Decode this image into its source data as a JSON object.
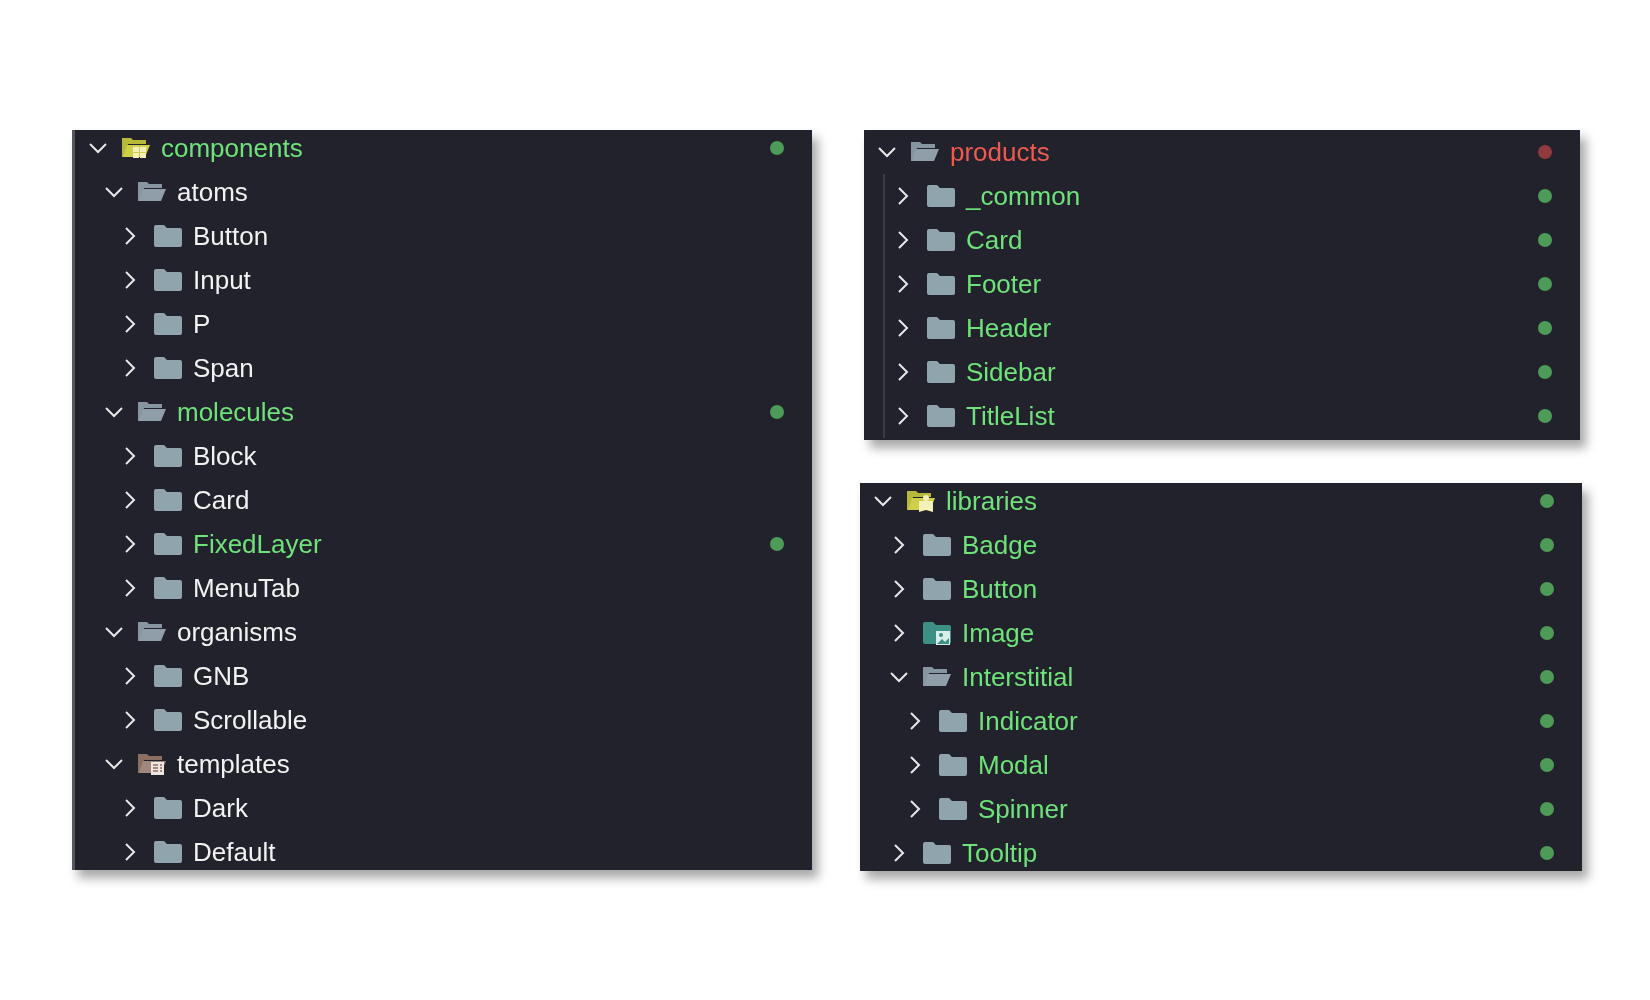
{
  "panels": [
    {
      "guide": false,
      "root": {
        "label": "components",
        "kind": "components",
        "expanded": true,
        "color": "#4e9a57",
        "children": [
          {
            "label": "atoms",
            "kind": "folder",
            "expanded": true,
            "children": [
              {
                "label": "Button",
                "kind": "folder",
                "expanded": false
              },
              {
                "label": "Input",
                "kind": "folder",
                "expanded": false
              },
              {
                "label": "P",
                "kind": "folder",
                "expanded": false
              },
              {
                "label": "Span",
                "kind": "folder",
                "expanded": false
              }
            ]
          },
          {
            "label": "molecules",
            "kind": "folder",
            "expanded": true,
            "color": "#4e9a57",
            "children": [
              {
                "label": "Block",
                "kind": "folder",
                "expanded": false
              },
              {
                "label": "Card",
                "kind": "folder",
                "expanded": false
              },
              {
                "label": "FixedLayer",
                "kind": "folder",
                "expanded": false,
                "color": "#4e9a57"
              },
              {
                "label": "MenuTab",
                "kind": "folder",
                "expanded": false
              }
            ]
          },
          {
            "label": "organisms",
            "kind": "folder",
            "expanded": true,
            "children": [
              {
                "label": "GNB",
                "kind": "folder",
                "expanded": false
              },
              {
                "label": "Scrollable",
                "kind": "folder",
                "expanded": false
              }
            ]
          },
          {
            "label": "templates",
            "kind": "templates",
            "expanded": true,
            "children": [
              {
                "label": "Dark",
                "kind": "folder",
                "expanded": false
              },
              {
                "label": "Default",
                "kind": "folder",
                "expanded": false
              }
            ]
          }
        ]
      }
    },
    {
      "guide": true,
      "root": {
        "label": "products",
        "kind": "folder",
        "expanded": true,
        "color": "#8f3b3b",
        "children": [
          {
            "label": "_common",
            "kind": "folder",
            "expanded": false,
            "color": "#4e9a57"
          },
          {
            "label": "Card",
            "kind": "folder",
            "expanded": false,
            "color": "#4e9a57"
          },
          {
            "label": "Footer",
            "kind": "folder",
            "expanded": false,
            "color": "#4e9a57"
          },
          {
            "label": "Header",
            "kind": "folder",
            "expanded": false,
            "color": "#4e9a57"
          },
          {
            "label": "Sidebar",
            "kind": "folder",
            "expanded": false,
            "color": "#4e9a57"
          },
          {
            "label": "TitleList",
            "kind": "folder",
            "expanded": false,
            "color": "#4e9a57"
          }
        ]
      }
    },
    {
      "guide": false,
      "root": {
        "label": "libraries",
        "kind": "libraries",
        "expanded": true,
        "color": "#4e9a57",
        "children": [
          {
            "label": "Badge",
            "kind": "folder",
            "expanded": false,
            "color": "#4e9a57"
          },
          {
            "label": "Button",
            "kind": "folder",
            "expanded": false,
            "color": "#4e9a57"
          },
          {
            "label": "Image",
            "kind": "image",
            "expanded": false,
            "color": "#4e9a57"
          },
          {
            "label": "Interstitial",
            "kind": "folder",
            "expanded": true,
            "color": "#4e9a57",
            "children": [
              {
                "label": "Indicator",
                "kind": "folder",
                "expanded": false,
                "color": "#4e9a57"
              },
              {
                "label": "Modal",
                "kind": "folder",
                "expanded": false,
                "color": "#4e9a57"
              },
              {
                "label": "Spinner",
                "kind": "folder",
                "expanded": false,
                "color": "#4e9a57"
              }
            ]
          },
          {
            "label": "Tooltip",
            "kind": "folder",
            "expanded": false,
            "color": "#4e9a57"
          }
        ]
      }
    }
  ]
}
